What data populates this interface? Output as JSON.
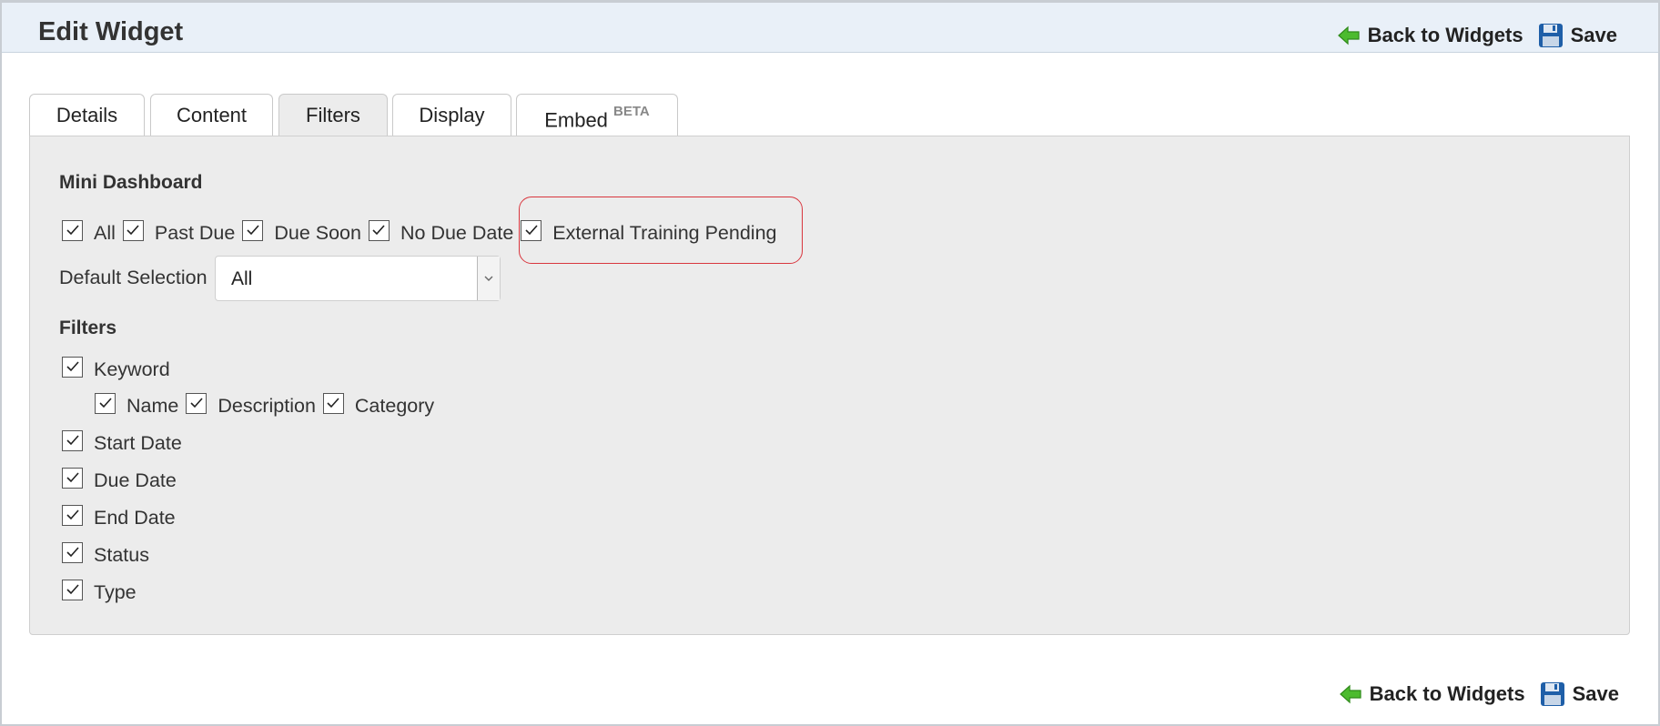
{
  "header": {
    "title": "Edit Widget",
    "back_label": "Back to Widgets",
    "save_label": "Save"
  },
  "tabs": [
    {
      "label": "Details"
    },
    {
      "label": "Content"
    },
    {
      "label": "Filters",
      "active": true
    },
    {
      "label": "Display"
    },
    {
      "label": "Embed",
      "badge": "BETA"
    }
  ],
  "mini_dashboard": {
    "title": "Mini Dashboard",
    "options": [
      {
        "label": "All",
        "checked": true
      },
      {
        "label": "Past Due",
        "checked": true
      },
      {
        "label": "Due Soon",
        "checked": true
      },
      {
        "label": "No Due Date",
        "checked": true
      },
      {
        "label": "External Training Pending",
        "checked": true,
        "highlighted": true
      }
    ],
    "default_selection_label": "Default Selection",
    "default_selection_value": "All"
  },
  "filters": {
    "title": "Filters",
    "keyword": {
      "label": "Keyword",
      "checked": true
    },
    "keyword_options": [
      {
        "label": "Name",
        "checked": true
      },
      {
        "label": "Description",
        "checked": true
      },
      {
        "label": "Category",
        "checked": true
      }
    ],
    "items": [
      {
        "label": "Start Date",
        "checked": true
      },
      {
        "label": "Due Date",
        "checked": true
      },
      {
        "label": "End Date",
        "checked": true
      },
      {
        "label": "Status",
        "checked": true
      },
      {
        "label": "Type",
        "checked": true
      }
    ]
  },
  "footer": {
    "back_label": "Back to Widgets",
    "save_label": "Save"
  },
  "colors": {
    "header_bg": "#e9f0f8",
    "panel_bg": "#ececec",
    "highlight": "#d9363e",
    "back_arrow": "#4cbb2e",
    "save_icon": "#1f5fa8"
  },
  "icons": {
    "back": "back-arrow-icon",
    "save": "floppy-disk-icon",
    "checkbox": "checkmark-icon",
    "select": "chevron-down-icon"
  }
}
